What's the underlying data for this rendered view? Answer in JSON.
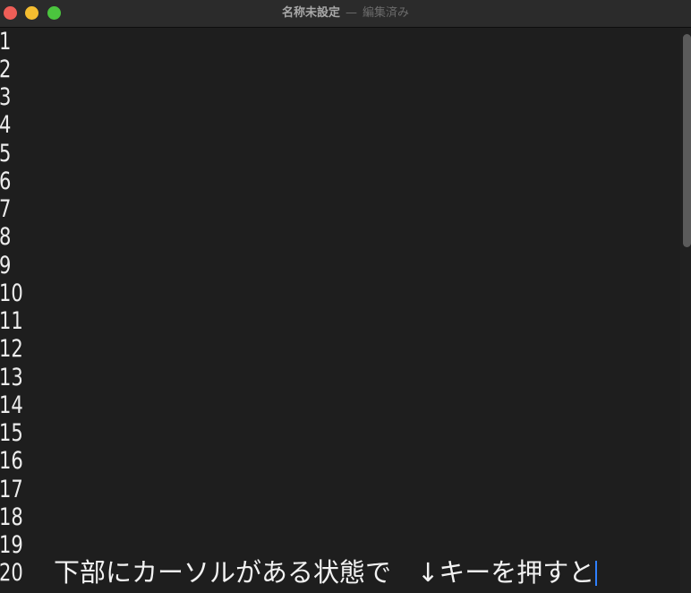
{
  "window": {
    "title": "名称未設定",
    "separator": "—",
    "status": "編集済み"
  },
  "editor": {
    "line_numbers": [
      "1",
      "2",
      "3",
      "4",
      "5",
      "6",
      "7",
      "8",
      "9",
      "10",
      "11",
      "12",
      "13",
      "14",
      "15",
      "16",
      "17",
      "18",
      "19",
      "20"
    ],
    "current_line_text": "下部にカーソルがある状態で　↓キーを押すと"
  },
  "colors": {
    "background": "#1e1e1e",
    "text": "#f2f2f2",
    "caret": "#2f80ff",
    "close": "#ee5e57",
    "minimize": "#f4bd30",
    "zoom": "#4bc53e"
  }
}
